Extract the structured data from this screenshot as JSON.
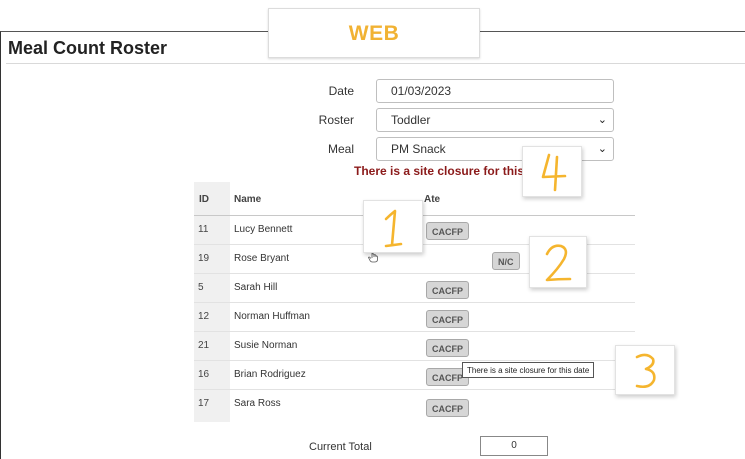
{
  "tab_label": "WEB",
  "page_title": "Meal Count Roster",
  "form": {
    "date_label": "Date",
    "date_value": "01/03/2023",
    "roster_label": "Roster",
    "roster_value": "Toddler",
    "meal_label": "Meal",
    "meal_value": "PM Snack"
  },
  "closure_message": "There is a site closure for this date",
  "table": {
    "headers": {
      "id": "ID",
      "name": "Name",
      "ate": "Ate"
    },
    "rows": [
      {
        "id": "11",
        "name": "Lucy Bennett",
        "ate": "CACFP"
      },
      {
        "id": "19",
        "name": "Rose Bryant",
        "ate": "N/C"
      },
      {
        "id": "5",
        "name": "Sarah Hill",
        "ate": "CACFP"
      },
      {
        "id": "12",
        "name": "Norman Huffman",
        "ate": "CACFP"
      },
      {
        "id": "21",
        "name": "Susie Norman",
        "ate": "CACFP"
      },
      {
        "id": "16",
        "name": "Brian Rodriguez",
        "ate": "CACFP"
      },
      {
        "id": "17",
        "name": "Sara Ross",
        "ate": "CACFP"
      }
    ]
  },
  "tooltip_text": "There is a site closure for this date",
  "annotations": [
    "1",
    "2",
    "3",
    "4"
  ],
  "current_total_label": "Current Total",
  "current_total_value": "0",
  "colors": {
    "tab_text": "#f1b233",
    "closure_text": "#8b1a1a",
    "annotation_digit": "#f5b52e"
  },
  "icons": {
    "chevron": "chevron-down-icon",
    "cursor": "hand-pointer-icon"
  }
}
